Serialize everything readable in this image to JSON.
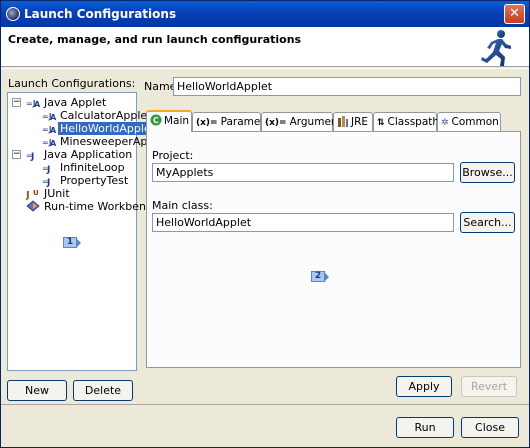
{
  "window": {
    "title": "Launch Configurations",
    "close_glyph": "✕"
  },
  "banner": {
    "text": "Create, manage, and run launch configurations",
    "icon": "runner-icon"
  },
  "left": {
    "label": "Launch Configurations:",
    "tree": [
      {
        "label": "Java Applet",
        "icon": "java-applet-icon",
        "expander": "−",
        "children": [
          {
            "label": "CalculatorApplet"
          },
          {
            "label": "HelloWorldApplet",
            "selected": true
          },
          {
            "label": "MinesweeperApplet"
          }
        ]
      },
      {
        "label": "Java Application",
        "icon": "java-application-icon",
        "expander": "−",
        "children": [
          {
            "label": "InfiniteLoop"
          },
          {
            "label": "PropertyTest"
          }
        ]
      },
      {
        "label": "JUnit",
        "icon": "junit-icon"
      },
      {
        "label": "Run-time Workbench",
        "icon": "workbench-icon"
      }
    ],
    "marker": "1",
    "new_label": "New",
    "delete_label": "Delete"
  },
  "right": {
    "name_label": "Name:",
    "name_value": "HelloWorldApplet",
    "tabs": [
      {
        "label": "Main",
        "icon": "main-tab-icon",
        "active": true
      },
      {
        "label": "Parameters",
        "icon": "parameters-tab-icon"
      },
      {
        "label": "Arguments",
        "icon": "arguments-tab-icon"
      },
      {
        "label": "JRE",
        "icon": "jre-tab-icon"
      },
      {
        "label": "Classpath",
        "icon": "classpath-tab-icon"
      },
      {
        "label": "Common",
        "icon": "common-tab-icon"
      }
    ],
    "project_label": "Project:",
    "project_value": "MyApplets",
    "browse_label": "Browse...",
    "main_class_label": "Main class:",
    "main_class_value": "HelloWorldApplet",
    "search_label": "Search...",
    "marker": "2",
    "apply_label": "Apply",
    "revert_label": "Revert"
  },
  "footer": {
    "run_label": "Run",
    "close_label": "Close"
  }
}
